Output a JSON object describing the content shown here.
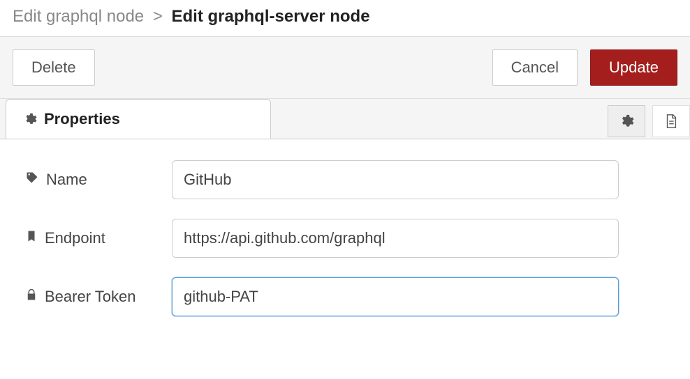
{
  "breadcrumb": {
    "parent": "Edit graphql node",
    "separator": ">",
    "current": "Edit graphql-server node"
  },
  "actions": {
    "delete_label": "Delete",
    "cancel_label": "Cancel",
    "update_label": "Update"
  },
  "tabs": {
    "properties_label": "Properties"
  },
  "fields": {
    "name": {
      "label": "Name",
      "value": "GitHub"
    },
    "endpoint": {
      "label": "Endpoint",
      "value": "https://api.github.com/graphql"
    },
    "bearer_token": {
      "label": "Bearer Token",
      "value": "github-PAT"
    }
  },
  "icons": {
    "gear": "gear-icon",
    "doc": "doc-icon",
    "tag": "tag-icon",
    "bookmark": "bookmark-icon",
    "lock": "lock-icon"
  }
}
